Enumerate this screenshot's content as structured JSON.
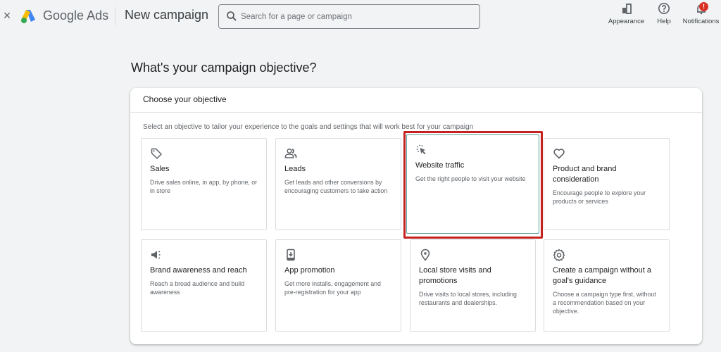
{
  "topbar": {
    "close_label": "×",
    "brand_google": "Google",
    "brand_ads": "Ads",
    "page_title": "New campaign",
    "search": {
      "placeholder": "Search for a page or campaign",
      "value": ""
    },
    "tools": [
      {
        "label": "Appearance",
        "icon": "appearance-icon"
      },
      {
        "label": "Help",
        "icon": "help-icon"
      },
      {
        "label": "Notifications",
        "icon": "bell-icon",
        "badge": "!"
      }
    ]
  },
  "main": {
    "heading": "What's your campaign objective?",
    "panel": {
      "title": "Choose your objective",
      "description": "Select an objective to tailor your experience to the goals and settings that will work best for your campaign",
      "selected_index": 2,
      "objectives": [
        {
          "icon": "tag-icon",
          "title": "Sales",
          "description": "Drive sales online, in app, by phone, or in store"
        },
        {
          "icon": "people-icon",
          "title": "Leads",
          "description": "Get leads and other conversions by encouraging customers to take action"
        },
        {
          "icon": "cursor-click-icon",
          "title": "Website traffic",
          "description": "Get the right people to visit your website"
        },
        {
          "icon": "heart-icon",
          "title": "Product and brand consideration",
          "description": "Encourage people to explore your products or services"
        },
        {
          "icon": "megaphone-icon",
          "title": "Brand awareness and reach",
          "description": "Reach a broad audience and build awareness"
        },
        {
          "icon": "phone-download-icon",
          "title": "App promotion",
          "description": "Get more installs, engagement and pre-registration for your app"
        },
        {
          "icon": "location-pin-icon",
          "title": "Local store visits and promotions",
          "description": "Drive visits to local stores, including restaurants and dealerships."
        },
        {
          "icon": "gear-icon",
          "title": "Create a campaign without a goal's guidance",
          "description": "Choose a campaign type first, without a recommendation based on your objective."
        }
      ]
    }
  },
  "colors": {
    "highlight": "#c5221f",
    "badge": "#d93025",
    "background": "#f1f3f4"
  }
}
